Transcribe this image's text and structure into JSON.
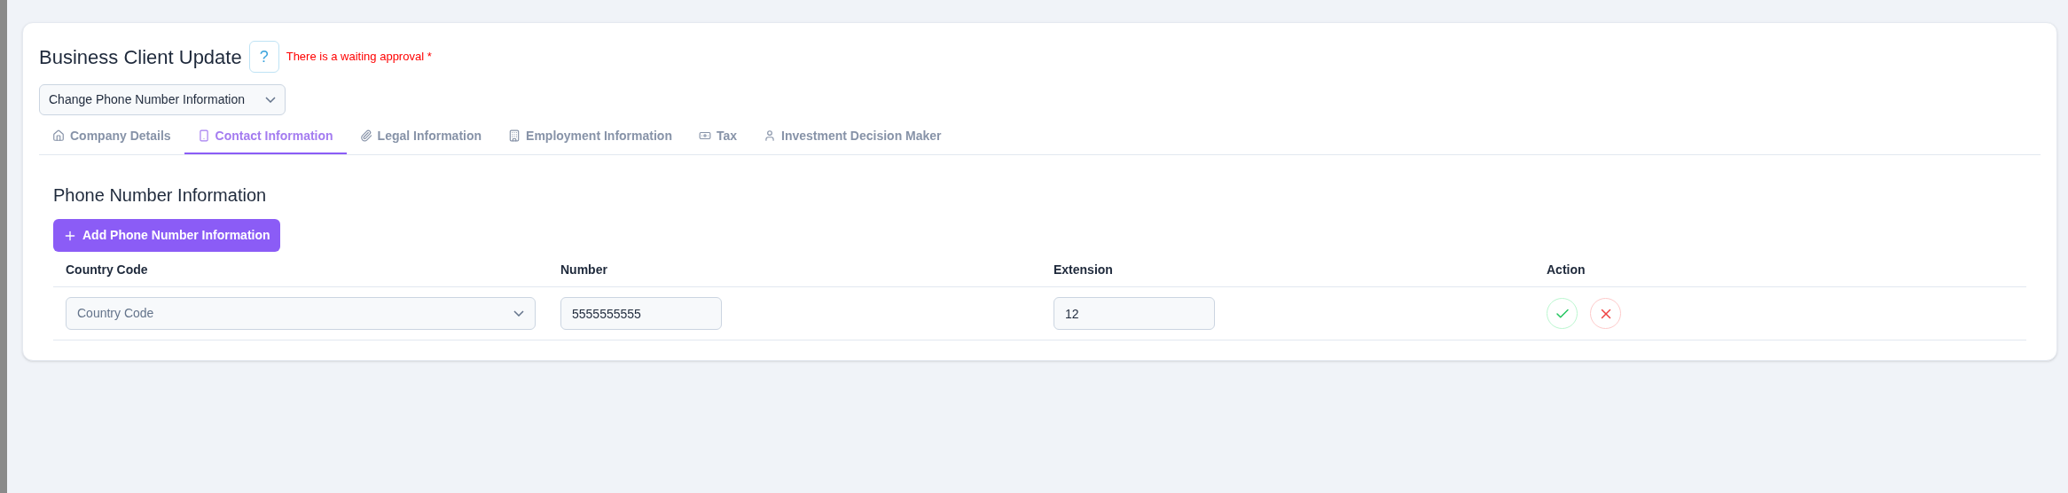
{
  "header": {
    "title": "Business Client Update",
    "help_button": "?",
    "warning": "There is a waiting approval *"
  },
  "request_type": {
    "value": "Change Phone Number Information"
  },
  "tabs": [
    {
      "label": "Company Details",
      "selected": false
    },
    {
      "label": "Contact Information",
      "selected": true
    },
    {
      "label": "Legal Information",
      "selected": false
    },
    {
      "label": "Employment Information",
      "selected": false
    },
    {
      "label": "Tax",
      "selected": false
    },
    {
      "label": "Investment Decision Maker",
      "selected": false
    }
  ],
  "section": {
    "title": "Phone Number Information",
    "add_button": "Add Phone Number Information"
  },
  "table": {
    "columns": [
      "Country Code",
      "Number",
      "Extension",
      "Action"
    ],
    "rows": [
      {
        "country_code": {
          "placeholder": "Country Code"
        },
        "number": "5555555555",
        "extension": "12"
      }
    ]
  }
}
